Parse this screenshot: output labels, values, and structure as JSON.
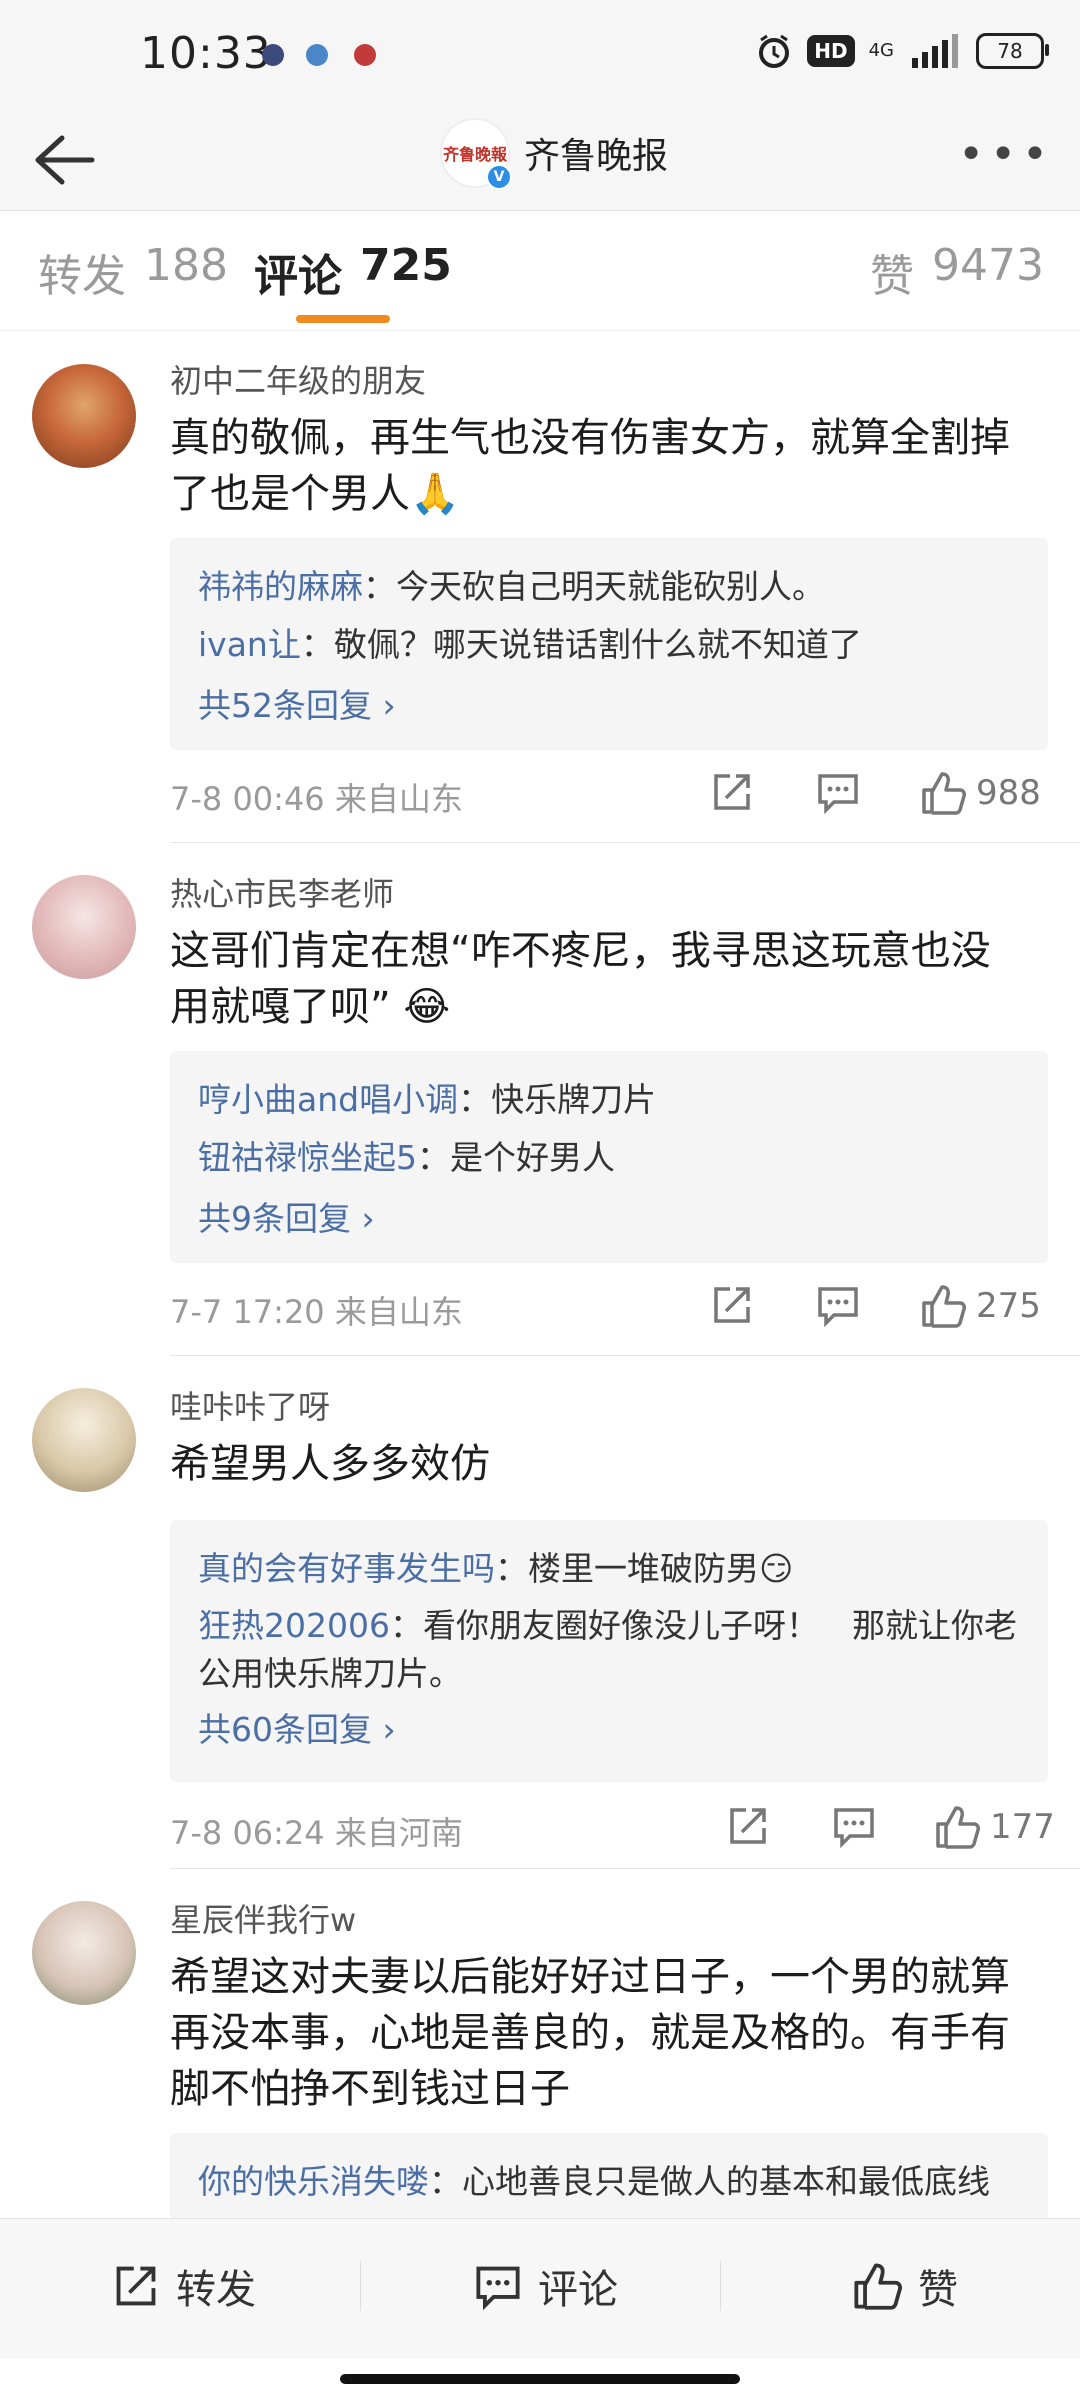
{
  "status_bar": {
    "time": "10:33",
    "network": "4G",
    "hd": "HD",
    "battery": "78"
  },
  "nav": {
    "back_icon": "back-arrow-icon",
    "title": "齐鲁晚报",
    "logo_text": "齐鲁晚報",
    "verified": "V",
    "more_icon": "more-dots-icon"
  },
  "tabs": [
    {
      "label": "转发",
      "count": "188"
    },
    {
      "label": "评论",
      "count": "725"
    },
    {
      "label": "赞",
      "count": "9473"
    }
  ],
  "comments": [
    {
      "user": "初中二年级的朋友",
      "text": "真的敬佩，再生气也没有伤害女方，就算全割掉了也是个男人🙏",
      "replies": [
        {
          "user": "祎祎的麻麻",
          "text": "今天砍自己明天就能砍别人。"
        },
        {
          "user": "ivan让",
          "text": "敬佩？哪天说错话割什么就不知道了"
        }
      ],
      "more": "共52条回复",
      "time": "7-8 00:46",
      "location": "来自山东",
      "likes": "988"
    },
    {
      "user": "热心市民李老师",
      "text": "这哥们肯定在想“咋不疼尼，我寻思这玩意也没用就嘎了呗” 😂",
      "replies": [
        {
          "user": "哼小曲and唱小调",
          "text": "快乐牌刀片"
        },
        {
          "user": "钮祜禄惊坐起5",
          "text": "是个好男人"
        }
      ],
      "more": "共9条回复",
      "time": "7-7 17:20",
      "location": "来自山东",
      "likes": "275"
    },
    {
      "user": "哇咔咔了呀",
      "text": "希望男人多多效仿",
      "replies": [
        {
          "user": "真的会有好事发生吗",
          "text": "楼里一堆破防男😏"
        },
        {
          "user": "狂热202006",
          "text": "看你朋友圈好像没儿子呀！　那就让你老公用快乐牌刀片。"
        }
      ],
      "more": "共60条回复",
      "time": "7-8 06:24",
      "location": "来自河南",
      "likes": "177"
    },
    {
      "user": "星辰伴我行w",
      "text": "希望这对夫妻以后能好好过日子，一个男的就算再没本事，心地是善良的，就是及格的。有手有脚不怕挣不到钱过日子",
      "replies": [
        {
          "user": "你的快乐消失喽",
          "text": "心地善良只是做人的基本和最低底线好嘛"
        }
      ]
    }
  ],
  "bottom_bar": {
    "repost": "转发",
    "comment": "评论",
    "like": "赞"
  },
  "colors": {
    "accent": "#f18a1f",
    "link": "#4b6fa5",
    "muted": "#9a9a9a"
  }
}
